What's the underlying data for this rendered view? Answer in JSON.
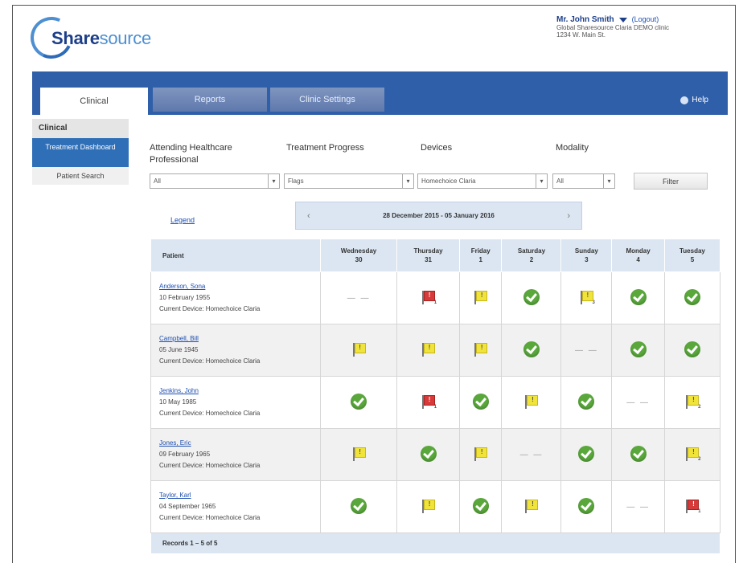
{
  "brand": {
    "part1": "Share",
    "part2": "source"
  },
  "user": {
    "name": "Mr. John Smith",
    "logout": "(Logout)",
    "clinic": "Global Sharesource Claria DEMO clinic",
    "address": "1234 W. Main St."
  },
  "tabs": [
    "Clinical",
    "Reports",
    "Clinic Settings"
  ],
  "help": "Help",
  "sidebar": {
    "heading": "Clinical",
    "items": [
      "Treatment Dashboard",
      "Patient Search"
    ]
  },
  "filters": {
    "labels": [
      "Attending Healthcare Professional",
      "Treatment Progress",
      "Devices",
      "Modality"
    ],
    "values": [
      "All",
      "Flags",
      "Homechoice Claria",
      "All"
    ],
    "button": "Filter"
  },
  "legend": "Legend",
  "date_range": "28 December 2015 - 05 January 2016",
  "columns": {
    "patient": "Patient",
    "days": [
      {
        "name": "Wednesday",
        "num": "30"
      },
      {
        "name": "Thursday",
        "num": "31"
      },
      {
        "name": "Friday",
        "num": "1"
      },
      {
        "name": "Saturday",
        "num": "2"
      },
      {
        "name": "Sunday",
        "num": "3"
      },
      {
        "name": "Monday",
        "num": "4"
      },
      {
        "name": "Tuesday",
        "num": "5"
      }
    ]
  },
  "rows": [
    {
      "name": "Anderson, Sona",
      "dob": "10 February 1955",
      "device": "Current Device: Homechoice Claria",
      "status": [
        {
          "t": "none"
        },
        {
          "t": "red",
          "n": "1"
        },
        {
          "t": "flag"
        },
        {
          "t": "ok"
        },
        {
          "t": "flag",
          "n": "3"
        },
        {
          "t": "ok"
        },
        {
          "t": "ok"
        }
      ]
    },
    {
      "name": "Campbell, Bill",
      "dob": "05 June 1945",
      "device": "Current Device: Homechoice Claria",
      "status": [
        {
          "t": "flag"
        },
        {
          "t": "flag"
        },
        {
          "t": "flag"
        },
        {
          "t": "ok"
        },
        {
          "t": "none"
        },
        {
          "t": "ok"
        },
        {
          "t": "ok"
        }
      ]
    },
    {
      "name": "Jenkins, John",
      "dob": "10 May 1985",
      "device": "Current Device: Homechoice Claria",
      "status": [
        {
          "t": "ok"
        },
        {
          "t": "red",
          "n": "1"
        },
        {
          "t": "ok"
        },
        {
          "t": "flag"
        },
        {
          "t": "ok"
        },
        {
          "t": "none"
        },
        {
          "t": "flag",
          "n": "2"
        }
      ]
    },
    {
      "name": "Jones, Eric",
      "dob": "09 February 1965",
      "device": "Current Device: Homechoice Claria",
      "status": [
        {
          "t": "flag"
        },
        {
          "t": "ok"
        },
        {
          "t": "flag"
        },
        {
          "t": "none"
        },
        {
          "t": "ok"
        },
        {
          "t": "ok"
        },
        {
          "t": "flag",
          "n": "2"
        }
      ]
    },
    {
      "name": "Taylor, Karl",
      "dob": "04 September 1965",
      "device": "Current Device: Homechoice Claria",
      "status": [
        {
          "t": "ok"
        },
        {
          "t": "flag"
        },
        {
          "t": "ok"
        },
        {
          "t": "flag"
        },
        {
          "t": "ok"
        },
        {
          "t": "none"
        },
        {
          "t": "red",
          "n": "1"
        }
      ]
    }
  ],
  "records": "Records 1 – 5 of 5",
  "colors": {
    "brand_blue": "#2f5fa8",
    "ok_green": "#5aa83c",
    "flag_yellow": "#f0e33a",
    "flag_red": "#d83a3a"
  }
}
